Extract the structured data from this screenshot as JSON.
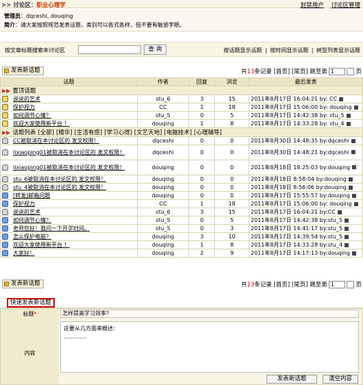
{
  "header": {
    "prefix": ">> 讨论区：",
    "forum_name": "职业心理学",
    "links": [
      "封禁用户",
      "讨论区管理"
    ]
  },
  "info": {
    "admin_label": "管理员",
    "admins": "：dqceshi, douqing",
    "intro_label": "简介",
    "intro": "：请大家按照规范发表话题，类别可以各式各样，但不要有敏感字眼。"
  },
  "search": {
    "label": "按文章标题搜索本讨论区",
    "value": "",
    "button": "查 询",
    "views": [
      "按话题显示话题",
      "|",
      "按时间显示话题",
      "|",
      "树型列表显示话题"
    ]
  },
  "toolbar": {
    "post_label": "发表新话题",
    "total_prefix": "共",
    "total": "13",
    "total_suffix": "条记录",
    "nav": "[首页] [尾页]",
    "jump": "跳至第",
    "page": "1",
    "page_suffix": "页"
  },
  "table": {
    "headers": [
      "话题",
      "作者",
      "回复",
      "浏览",
      "最后发表"
    ],
    "pinned_section": "置顶话题",
    "list_section": "话题列表",
    "categories": [
      "[全部]",
      "[精华]",
      "[生活有感]",
      "[学习心得]",
      "[文艺天地]",
      "[电脑技术]",
      "[心理辅导]"
    ],
    "pinned": [
      {
        "title": "说说的艺术",
        "author": "stu_6",
        "replies": "3",
        "views": "15",
        "last": "2011年8月17日 16:04:21 by: CC"
      },
      {
        "title": "保护视力",
        "author": "CC",
        "replies": "1",
        "views": "18",
        "last": "2011年8月17日 15:06:00 by: douqing"
      },
      {
        "title": "如何调节心情？",
        "author": "stu_5",
        "replies": "0",
        "views": "5",
        "last": "2011年8月17日 14:42:38 by: stu_5"
      },
      {
        "title": "欢迎大家使用新平台 ！",
        "author": "douqing",
        "replies": "1",
        "views": "8",
        "last": "2011年8月17日 14:33:28 by: stu_4"
      }
    ],
    "topics": [
      {
        "title": "CC被取消在本讨论区的 发文权限！",
        "author": "dqceshi",
        "replies": "0",
        "views": "0",
        "last": "2011年8月30日 14:48:35 by:dqceshi",
        "icon": "lock",
        "tall": false
      },
      {
        "title": "lixiaoping01被取消在本讨论区的 发文权限！",
        "author": "dqceshi",
        "replies": "0",
        "views": "0",
        "last": "2011年8月30日 14:48:21 by:dqceshi",
        "icon": "lock",
        "tall": true
      },
      {
        "title": "lixiaoping01被取消在本讨论区的 发文权限！",
        "author": "douqing",
        "replies": "0",
        "views": "0",
        "last": "2011年8月18日 18:25:03 by:douqing",
        "icon": "lock",
        "tall": true
      },
      {
        "title": "stu_6被取消在本讨论区的 发文权限！",
        "author": "douqing",
        "replies": "0",
        "views": "0",
        "last": "2011年8月18日 8:58:04 by:douqing",
        "icon": "lock",
        "tall": false
      },
      {
        "title": "stu_4被取消在本讨论区的 发文权限！",
        "author": "douqing",
        "replies": "0",
        "views": "0",
        "last": "2011年8月18日 8:56:06 by:douqing",
        "icon": "lock",
        "tall": false
      },
      {
        "title": "[转发]邮箱问题",
        "author": "douqing",
        "replies": "0",
        "views": "0",
        "last": "2011年8月17日 15:55:57 by:douqing",
        "icon": "blue",
        "tall": false
      },
      {
        "title": "保护视力",
        "author": "CC",
        "replies": "1",
        "views": "18",
        "last": "2011年8月17日 15:06:00 by: douqing",
        "icon": "blue",
        "tall": false
      },
      {
        "title": "说说的艺术",
        "author": "stu_6",
        "replies": "3",
        "views": "15",
        "last": "2011年8月17日 16:04:21 by:CC",
        "icon": "lock",
        "tall": false
      },
      {
        "title": "如何调节心情？",
        "author": "stu_5",
        "replies": "0",
        "views": "5",
        "last": "2011年8月17日 14:42:38 by:stu_5",
        "icon": "blue",
        "tall": false
      },
      {
        "title": "老师您好！我问一下开学时间。",
        "author": "stu_5",
        "replies": "0",
        "views": "3",
        "last": "2011年8月17日 14:41:17 by:stu_5",
        "icon": "blue",
        "tall": false
      },
      {
        "title": "怎么保护电脑？",
        "author": "douqing",
        "replies": "3",
        "views": "10",
        "last": "2011年8月17日 14:39:54 by:stu_5",
        "icon": "blue",
        "tall": false
      },
      {
        "title": "欢迎大家使用新平台 ！",
        "author": "douqing",
        "replies": "1",
        "views": "8",
        "last": "2011年8月17日 14:33:28 by:stu_4",
        "icon": "blue",
        "tall": false
      },
      {
        "title": "大家好！",
        "author": "douqing",
        "replies": "2",
        "views": "9",
        "last": "2011年8月17日 14:17:13 by:douqing",
        "icon": "blue",
        "tall": false
      }
    ]
  },
  "quickpost": {
    "tab": "快速发表新话题",
    "title_label": "标题",
    "title_star": "*",
    "title_value": "怎样提高学习效率?",
    "body_label": "内容",
    "body_value": "这要从几方面来概述：\n.............",
    "submit": "发表新话题",
    "clear": "清空内容"
  }
}
